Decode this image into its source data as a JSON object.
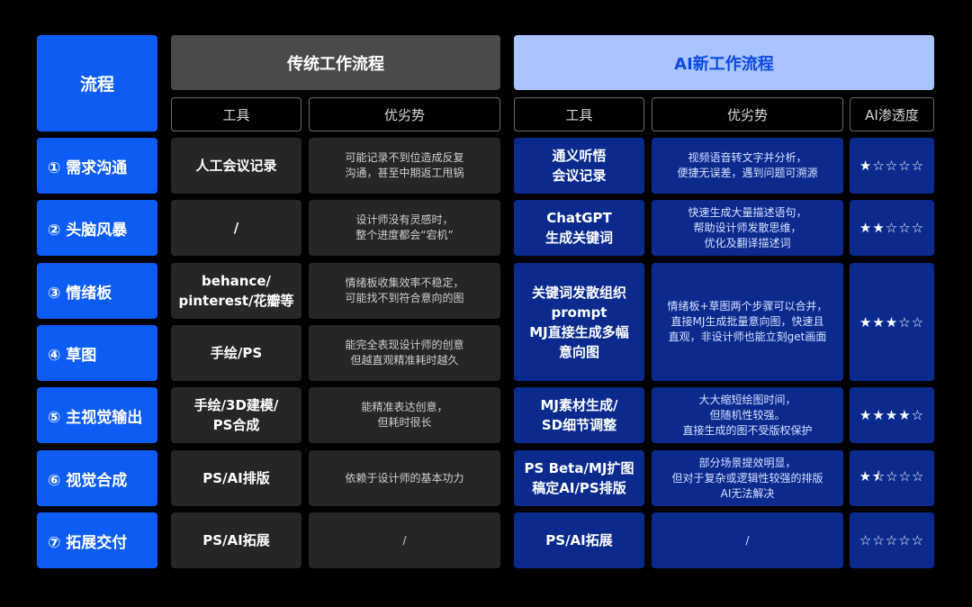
{
  "header": {
    "process_label": "流程",
    "traditional_title": "传统工作流程",
    "ai_title": "AI新工作流程",
    "trad_tool_label": "工具",
    "trad_pros_label": "优劣势",
    "ai_tool_label": "工具",
    "ai_pros_label": "优劣势",
    "ai_penetration_label": "AI渗透度"
  },
  "steps": [
    "① 需求沟通",
    "② 头脑风暴",
    "③ 情绪板",
    "④ 草图",
    "⑤ 主视觉输出",
    "⑥ 视觉合成",
    "⑦ 拓展交付"
  ],
  "trad_tools": [
    "人工会议记录",
    "/",
    "behance/\npinterest/花瓣等",
    "手绘/PS",
    "手绘/3D建模/\nPS合成",
    "PS/AI排版",
    "PS/AI拓展"
  ],
  "trad_pros": [
    "可能记录不到位造成反复\n沟通，甚至中期返工甩锅",
    "设计师没有灵感时，\n整个进度都会“宕机”",
    "情绪板收集效率不稳定，\n可能找不到符合意向的图",
    "能完全表现设计师的创意\n但越直观精准耗时越久",
    "能精准表达创意，\n但耗时很长",
    "依赖于设计师的基本功力",
    "/"
  ],
  "ai_tools": [
    "通义听悟\n会议记录",
    "ChatGPT\n生成关键词",
    "关键词发散组织\nprompt\nMJ直接生成多幅\n意向图",
    "MJ素材生成/\nSD细节调整",
    "PS Beta/MJ扩图\n稿定AI/PS排版",
    "PS/AI拓展"
  ],
  "ai_pros": [
    "视频语音转文字并分析，\n便捷无误差，遇到问题可溯源",
    "快速生成大量描述语句，\n帮助设计师发散思维，\n优化及翻译描述词",
    "情绪板+草图两个步骤可以合并，\n直接MJ生成批量意向图，快速且\n直观，非设计师也能立刻get画面",
    "大大缩短绘图时间，\n但随机性较强。\n直接生成的图不受版权保护",
    "部分场景提效明显，\n但对于复杂或逻辑性较强的排版\nAI无法解决",
    "/"
  ],
  "ai_penetration": [
    "★☆☆☆☆",
    "★★☆☆☆",
    "★★★☆☆",
    "★★★★☆",
    "★⯪☆☆☆",
    "☆☆☆☆☆"
  ],
  "colors": {
    "step_blue": "#0d5cf5",
    "trad_header": "#4a4a4a",
    "ai_header": "#a9c4ff",
    "ai_header_text": "#0b49e6",
    "trad_cell": "#262626",
    "ai_cell": "#0a2a8e",
    "background": "#000000"
  }
}
